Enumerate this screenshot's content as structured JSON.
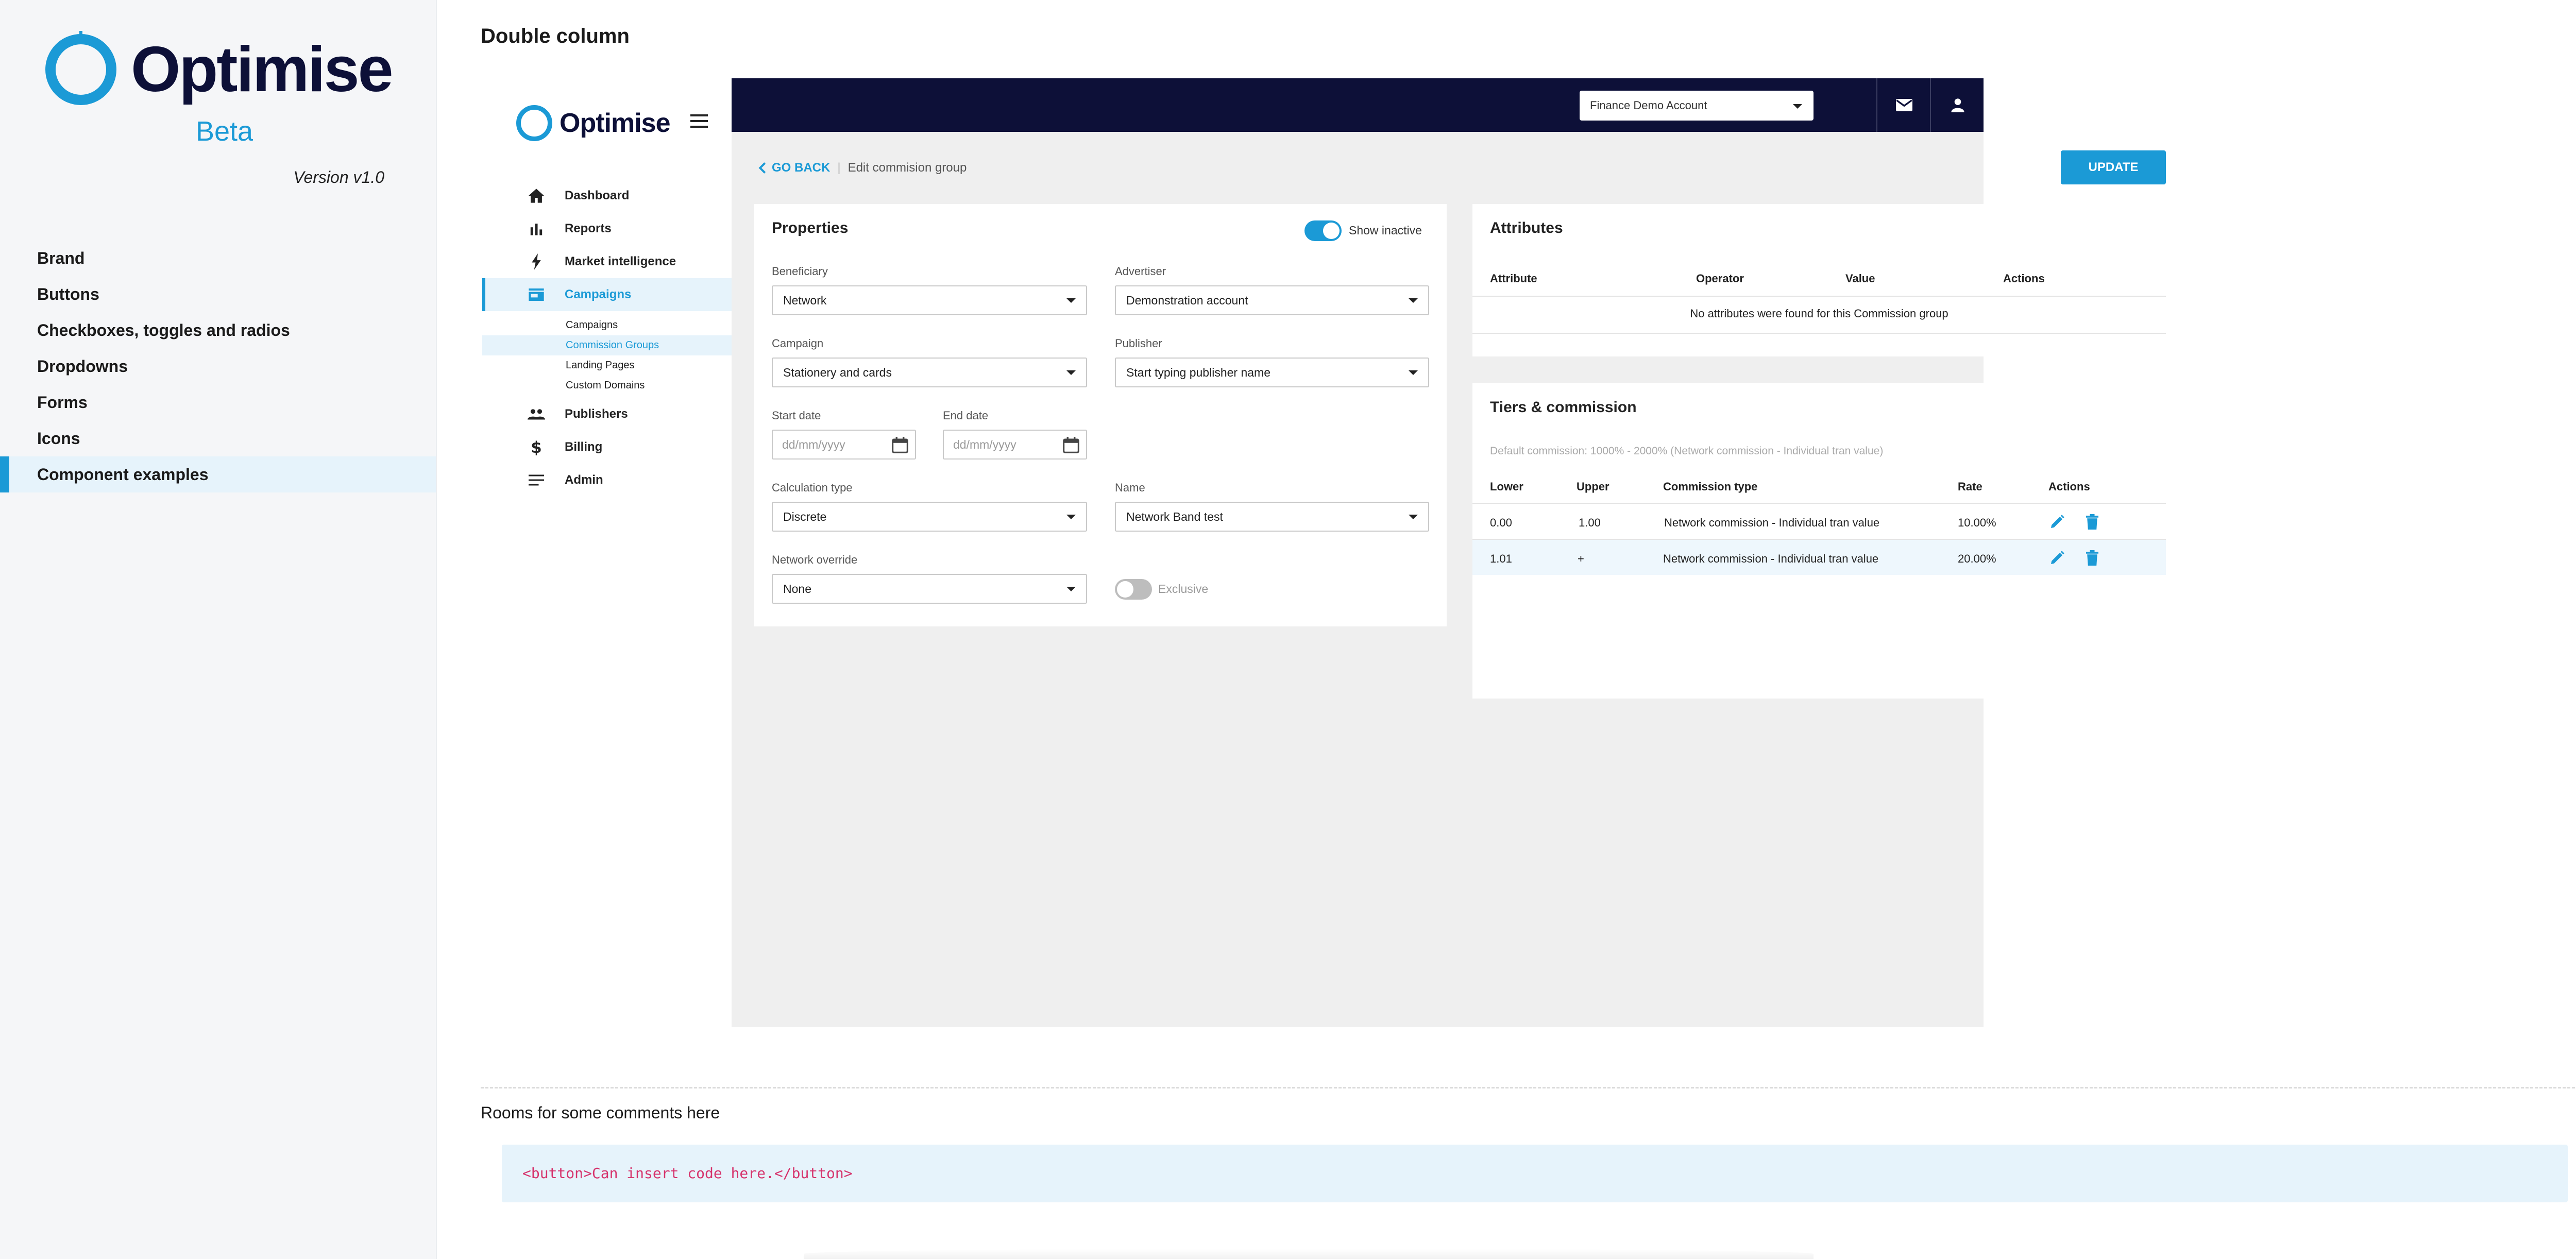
{
  "styleguide": {
    "logo_text": "Optimise",
    "beta": "Beta",
    "version": "Version v1.0",
    "nav": [
      "Brand",
      "Buttons",
      "Checkboxes, toggles and radios",
      "Dropdowns",
      "Forms",
      "Icons",
      "Component examples"
    ],
    "active_nav": "Component examples"
  },
  "page_title": "Double column",
  "app": {
    "logo_text": "Optimise",
    "nav": [
      {
        "label": "Dashboard",
        "icon": "home-icon"
      },
      {
        "label": "Reports",
        "icon": "bar-chart-icon"
      },
      {
        "label": "Market intelligence",
        "icon": "bolt-icon"
      },
      {
        "label": "Campaigns",
        "icon": "store-icon"
      },
      {
        "label": "Publishers",
        "icon": "people-icon"
      },
      {
        "label": "Billing",
        "icon": "dollar-icon"
      },
      {
        "label": "Admin",
        "icon": "lines-icon"
      }
    ],
    "campaigns_sub": [
      "Campaigns",
      "Commission Groups",
      "Landing Pages",
      "Custom Domains"
    ],
    "active_sub": "Commission Groups",
    "account": "Finance Demo Account",
    "breadcrumb": {
      "back": "GO BACK",
      "current": "Edit commision group"
    },
    "update_label": "UPDATE",
    "properties": {
      "title": "Properties",
      "show_inactive": "Show inactive",
      "beneficiary_label": "Beneficiary",
      "beneficiary_value": "Network",
      "advertiser_label": "Advertiser",
      "advertiser_value": "Demonstration account",
      "campaign_label": "Campaign",
      "campaign_value": "Stationery and cards",
      "publisher_label": "Publisher",
      "publisher_placeholder": "Start typing publisher name",
      "start_label": "Start date",
      "end_label": "End date",
      "date_placeholder": "dd/mm/yyyy",
      "calc_label": "Calculation type",
      "calc_value": "Discrete",
      "name_label": "Name",
      "name_value": "Network Band test",
      "override_label": "Network override",
      "override_value": "None",
      "exclusive_label": "Exclusive"
    },
    "attributes": {
      "title": "Attributes",
      "headers": [
        "Attribute",
        "Operator",
        "Value",
        "Actions"
      ],
      "empty": "No attributes were found for this Commission group"
    },
    "tiers": {
      "title": "Tiers & commission",
      "default_note": "Default commission: 1000% - 2000% (Network commission - Individual tran value)",
      "headers": [
        "Lower",
        "Upper",
        "Commission type",
        "Rate",
        "Actions"
      ],
      "rows": [
        [
          "0.00",
          "1.00",
          "Network commission - Individual tran value",
          "10.00%"
        ],
        [
          "1.01",
          "+",
          "Network commission - Individual tran value",
          "20.00%"
        ]
      ]
    }
  },
  "comment": "Rooms for some comments here",
  "code": "<button>Can insert code here.</button>",
  "colors": {
    "brand_blue": "#1b9ad6",
    "navy": "#0d1038",
    "content_bg": "#efefef"
  }
}
